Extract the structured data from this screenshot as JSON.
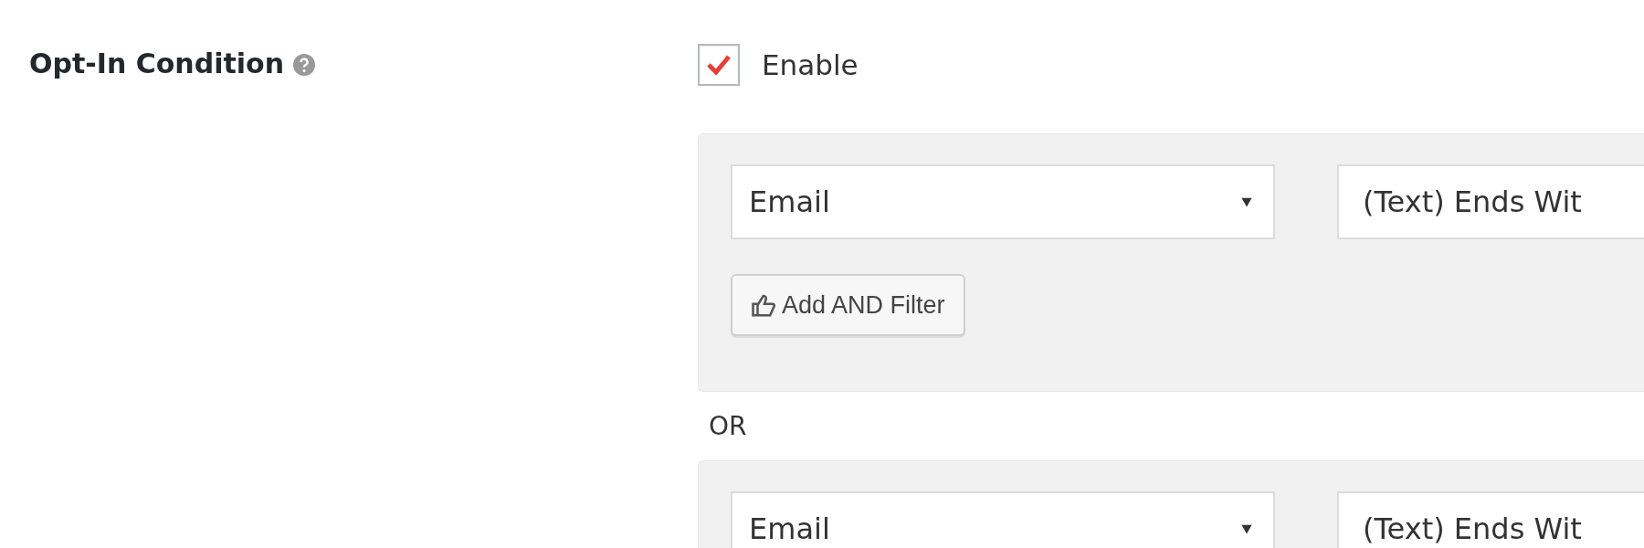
{
  "field": {
    "label": "Opt-In Condition",
    "enable": {
      "label": "Enable",
      "checked": true
    },
    "blocks": [
      {
        "kind": "group",
        "filters": [
          {
            "field": "Email",
            "operator": "(Text) Ends Wit"
          }
        ],
        "button": "Add AND Filter"
      },
      {
        "kind": "separator",
        "text": "OR"
      },
      {
        "kind": "group",
        "filters": [
          {
            "field": "Email",
            "operator": "(Text) Ends Wit"
          }
        ]
      }
    ]
  }
}
